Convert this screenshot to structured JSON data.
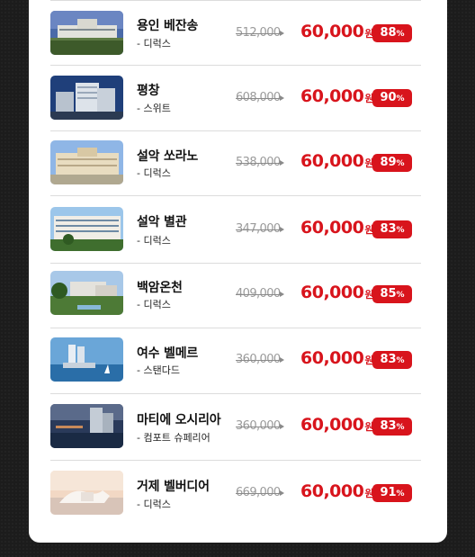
{
  "hotels": [
    {
      "name": "용인 베잔송",
      "room": "- 디럭스",
      "original_price": "512,000",
      "sale_price": "60,000",
      "currency": "원",
      "discount": "88",
      "pct": "%",
      "icon": "hotel-photo"
    },
    {
      "name": "평창",
      "room": "- 스위트",
      "original_price": "608,000",
      "sale_price": "60,000",
      "currency": "원",
      "discount": "90",
      "pct": "%",
      "icon": "hotel-photo"
    },
    {
      "name": "설악 쏘라노",
      "room": "- 디럭스",
      "original_price": "538,000",
      "sale_price": "60,000",
      "currency": "원",
      "discount": "89",
      "pct": "%",
      "icon": "hotel-photo"
    },
    {
      "name": "설악 별관",
      "room": "- 디럭스",
      "original_price": "347,000",
      "sale_price": "60,000",
      "currency": "원",
      "discount": "83",
      "pct": "%",
      "icon": "hotel-photo"
    },
    {
      "name": "백암온천",
      "room": "- 디럭스",
      "original_price": "409,000",
      "sale_price": "60,000",
      "currency": "원",
      "discount": "85",
      "pct": "%",
      "icon": "hotel-photo"
    },
    {
      "name": "여수 벨메르",
      "room": "- 스탠다드",
      "original_price": "360,000",
      "sale_price": "60,000",
      "currency": "원",
      "discount": "83",
      "pct": "%",
      "icon": "hotel-photo"
    },
    {
      "name": "마티에 오시리아",
      "room": "- 컴포트 슈페리어",
      "original_price": "360,000",
      "sale_price": "60,000",
      "currency": "원",
      "discount": "83",
      "pct": "%",
      "icon": "hotel-photo"
    },
    {
      "name": "거제 벨버디어",
      "room": "- 디럭스",
      "original_price": "669,000",
      "sale_price": "60,000",
      "currency": "원",
      "discount": "91",
      "pct": "%",
      "icon": "hotel-photo"
    }
  ],
  "colors": {
    "accent": "#d8141c",
    "background": "#1c1c1c",
    "card": "#ffffff",
    "strike": "#9a9a9a"
  }
}
